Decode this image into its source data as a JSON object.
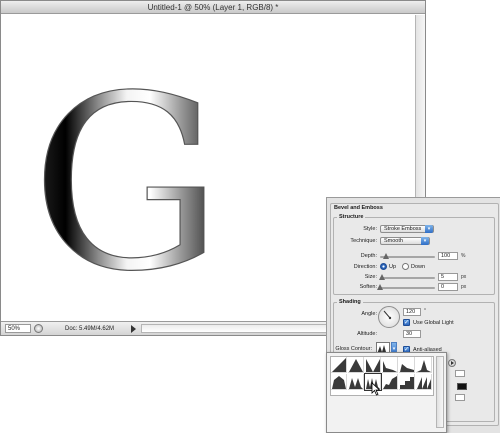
{
  "document": {
    "title": "Untitled-1 @ 50% (Layer 1, RGB/8) *",
    "letter": "G",
    "zoom": "50%",
    "doc_info": "Doc: 5.49M/4.62M"
  },
  "layer_style": {
    "section_title": "Bevel and Emboss",
    "structure": {
      "legend": "Structure",
      "style_label": "Style:",
      "style_value": "Stroke Emboss",
      "technique_label": "Technique:",
      "technique_value": "Smooth",
      "depth_label": "Depth:",
      "depth_value": "100",
      "depth_fraction": 0.1,
      "depth_unit": "%",
      "direction_label": "Direction:",
      "direction_up": "Up",
      "direction_down": "Down",
      "direction_selected": "Up",
      "size_label": "Size:",
      "size_value": "5",
      "size_fraction": 0.04,
      "size_unit": "px",
      "soften_label": "Soften:",
      "soften_value": "0",
      "soften_fraction": 0.0,
      "soften_unit": "px"
    },
    "shading": {
      "legend": "Shading",
      "angle_label": "Angle:",
      "angle_value": "120",
      "angle_unit": "°",
      "use_global_light_label": "Use Global Light",
      "use_global_light_checked": true,
      "altitude_label": "Altitude:",
      "altitude_value": "30",
      "gloss_contour_label": "Gloss Contour:",
      "anti_aliased_label": "Anti-aliased",
      "anti_aliased_checked": true
    }
  },
  "contour_picker": {
    "presets": [
      "linear",
      "cone",
      "cone-inverted",
      "cove-deep",
      "cove-shallow",
      "gaussian",
      "half-round",
      "ring",
      "ring-double",
      "rolling-slope",
      "rounded-steps",
      "sawtooth"
    ],
    "selected_index": 8
  }
}
